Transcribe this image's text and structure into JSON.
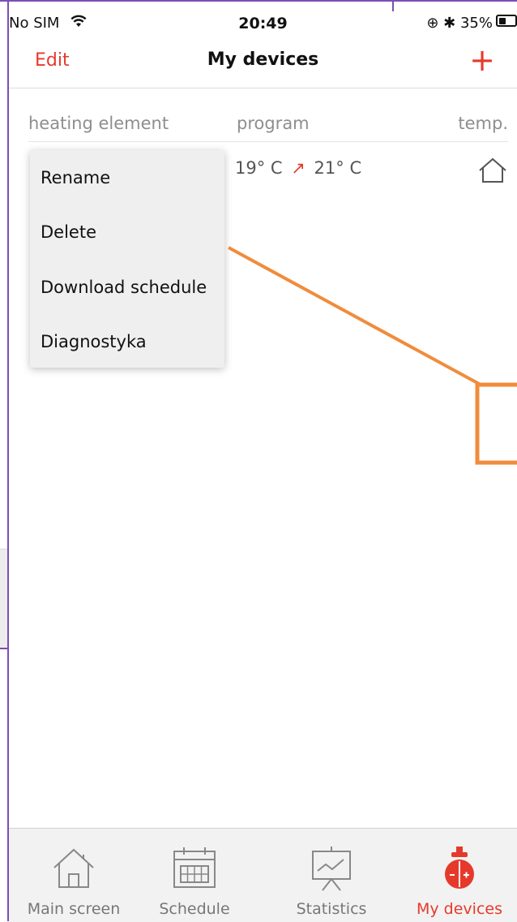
{
  "status_bar": {
    "carrier": "No SIM",
    "time": "20:49",
    "battery": "35%"
  },
  "navbar": {
    "edit_label": "Edit",
    "title": "My devices",
    "add_label": "+"
  },
  "table": {
    "headers": [
      "heating element",
      "program",
      "temp."
    ],
    "rows": [
      {
        "program_from": "19° C",
        "program_to": "21° C",
        "temp_icon": "home-outline-icon"
      }
    ]
  },
  "context_menu": {
    "items": [
      "Rename",
      "Delete",
      "Download schedule",
      "Diagnostyka"
    ]
  },
  "tabbar": {
    "items": [
      {
        "label": "Main screen",
        "icon": "home-icon",
        "active": false
      },
      {
        "label": "Schedule",
        "icon": "calendar-icon",
        "active": false
      },
      {
        "label": "Statistics",
        "icon": "chart-board-icon",
        "active": false
      },
      {
        "label": "My devices",
        "icon": "heater-device-icon",
        "active": true
      }
    ]
  },
  "colors": {
    "accent": "#e53a2b",
    "annotation_orange": "#f08c3c",
    "frame_purple": "#7a4fb5"
  }
}
